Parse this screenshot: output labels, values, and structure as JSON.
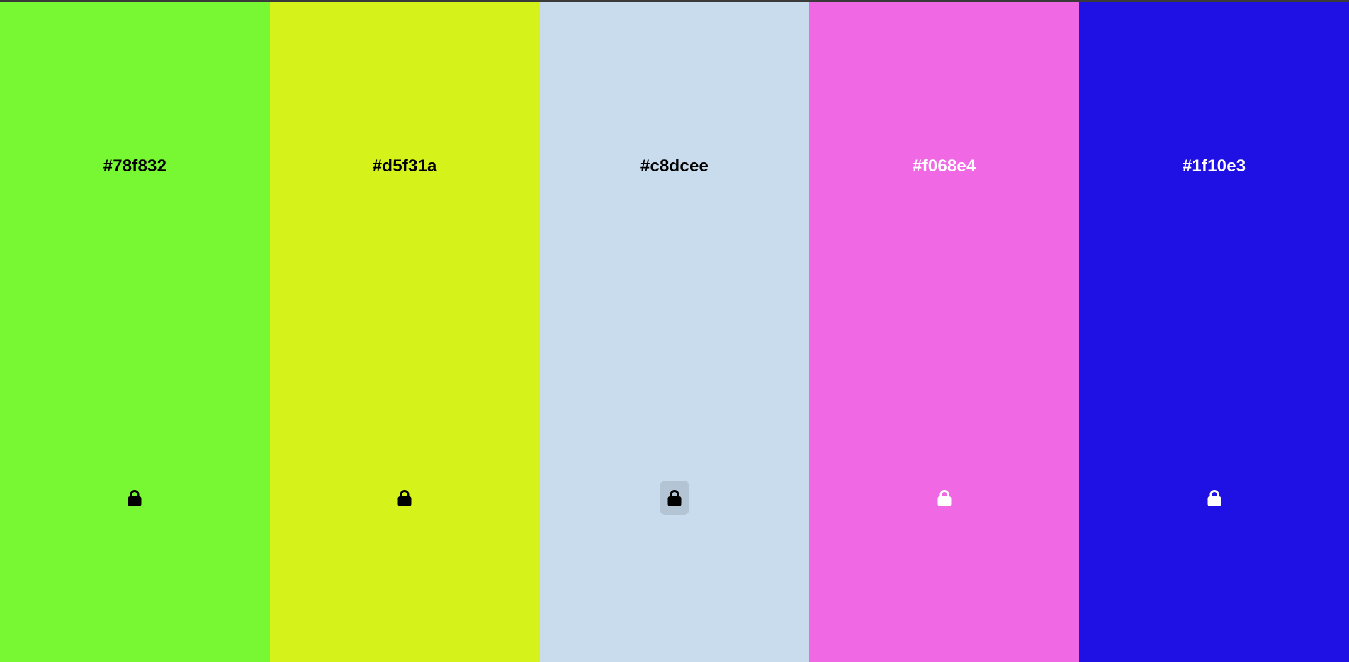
{
  "palette": {
    "swatches": [
      {
        "hex_label": "#78f832",
        "bg": "#78f832",
        "text_color": "#000000",
        "lock_icon": "lock-icon",
        "locked": true,
        "hovered": false
      },
      {
        "hex_label": "#d5f31a",
        "bg": "#d5f31a",
        "text_color": "#000000",
        "lock_icon": "lock-icon",
        "locked": true,
        "hovered": false
      },
      {
        "hex_label": "#c8dcee",
        "bg": "#c8dcee",
        "text_color": "#000000",
        "lock_icon": "lock-icon",
        "locked": true,
        "hovered": true
      },
      {
        "hex_label": "#f068e4",
        "bg": "#f068e4",
        "text_color": "#ffffff",
        "lock_icon": "lock-icon",
        "locked": true,
        "hovered": false
      },
      {
        "hex_label": "#1f10e3",
        "bg": "#1f10e3",
        "text_color": "#ffffff",
        "lock_icon": "lock-icon",
        "locked": true,
        "hovered": false
      }
    ]
  }
}
